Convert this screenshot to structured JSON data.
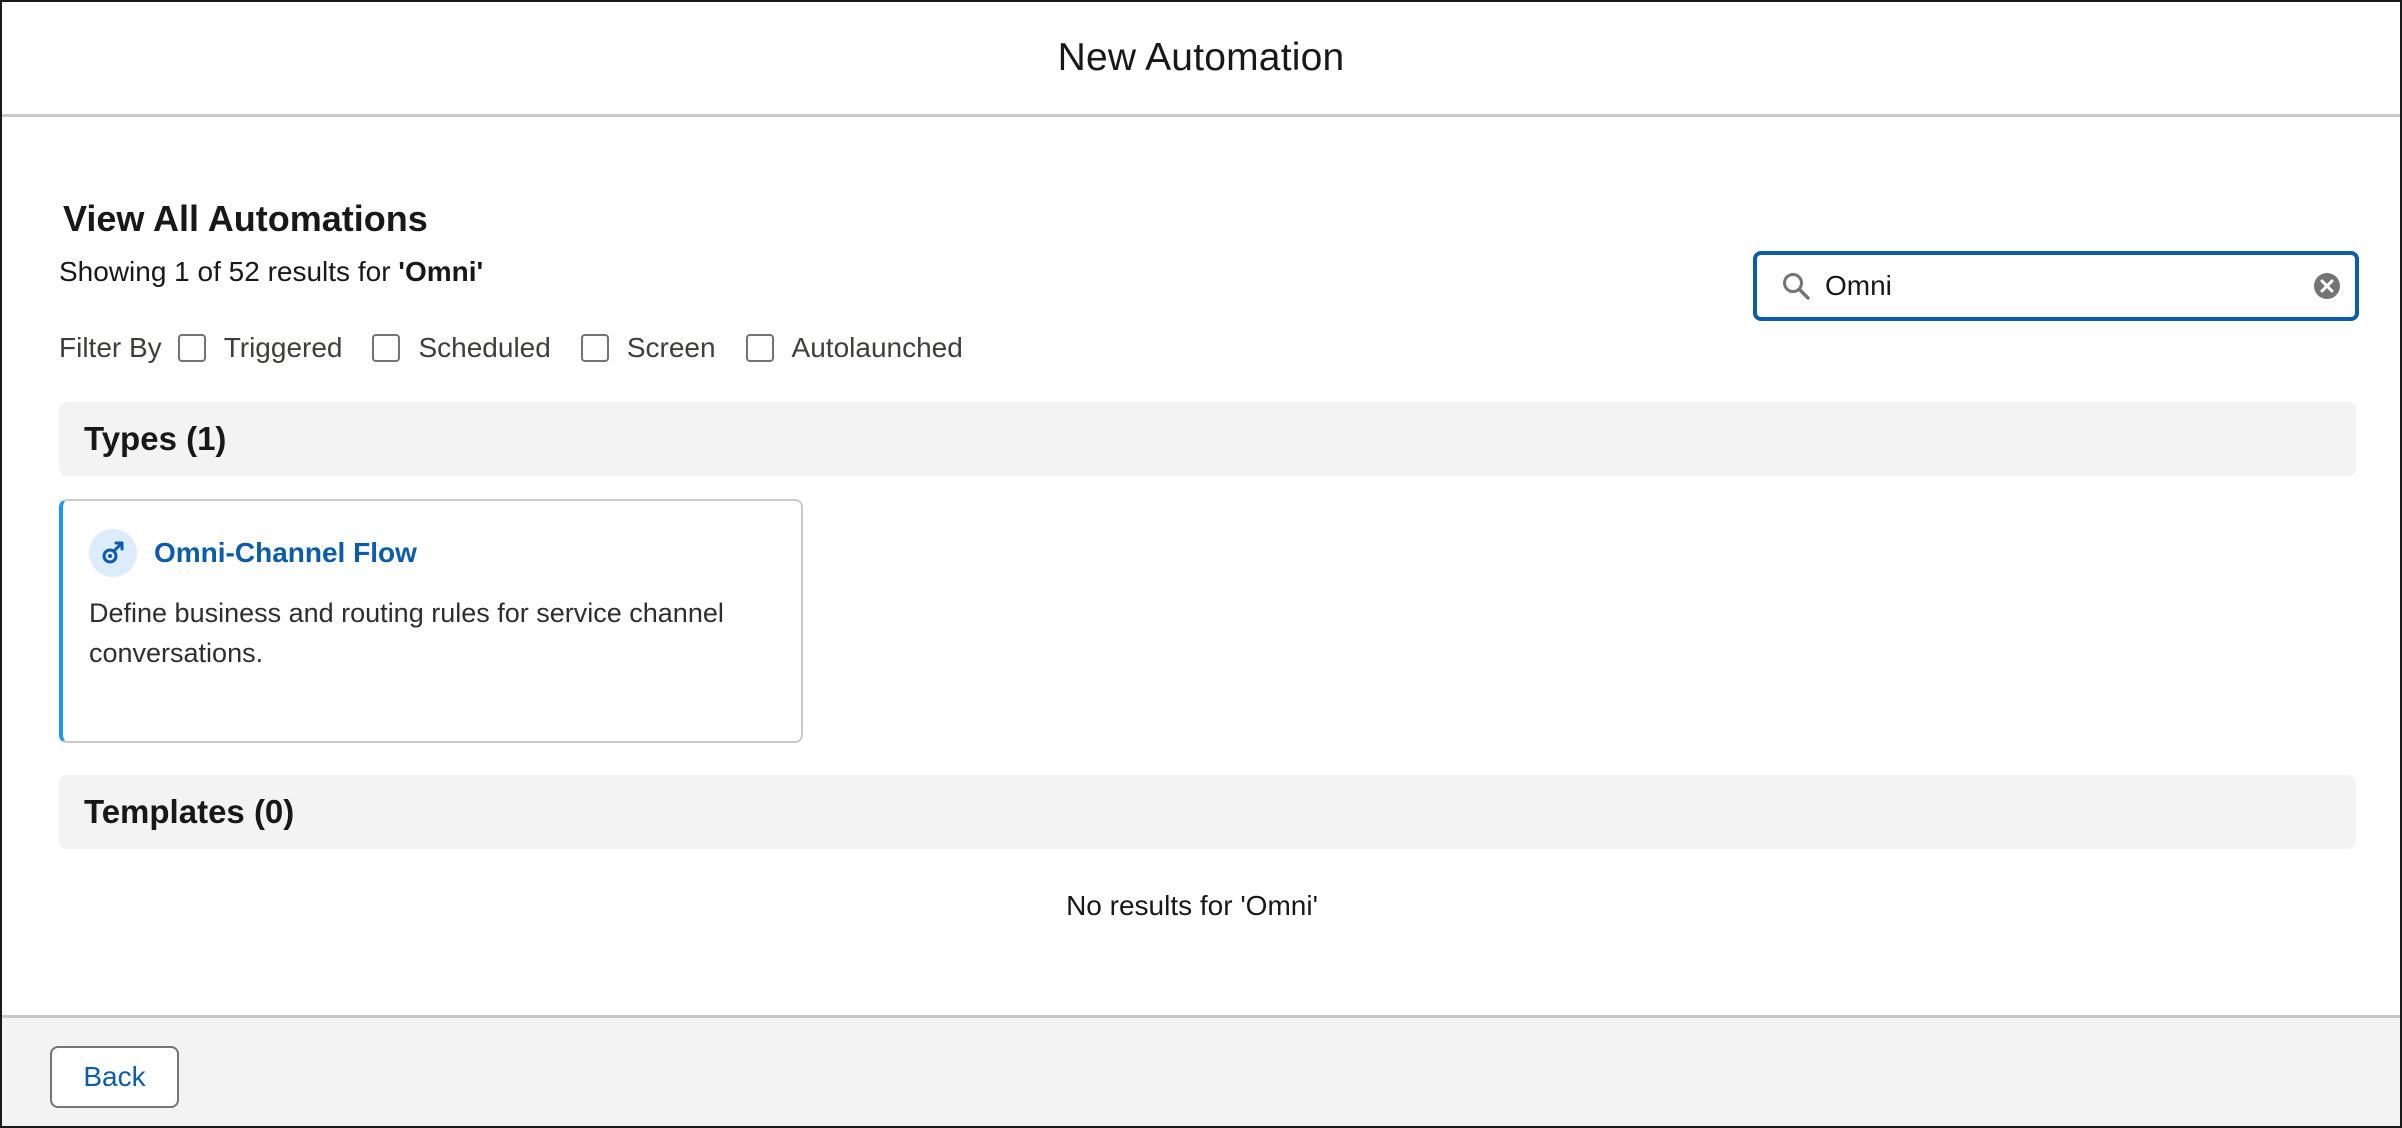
{
  "modal": {
    "title": "New Automation"
  },
  "page": {
    "heading": "View All Automations",
    "results_prefix": "Showing 1 of 52 results for ",
    "results_query": "'Omni'"
  },
  "filters": {
    "label": "Filter By",
    "options": [
      {
        "label": "Triggered",
        "checked": false
      },
      {
        "label": "Scheduled",
        "checked": false
      },
      {
        "label": "Screen",
        "checked": false
      },
      {
        "label": "Autolaunched",
        "checked": false
      }
    ]
  },
  "search": {
    "value": "Omni",
    "icon": "search-icon",
    "clear_icon": "clear-icon"
  },
  "types_section": {
    "title": "Types (1)",
    "cards": [
      {
        "title": "Omni-Channel Flow",
        "description": "Define business and routing rules for service channel conversations.",
        "icon": "omni-channel-flow-icon"
      }
    ]
  },
  "templates_section": {
    "title": "Templates (0)",
    "empty_message": "No results for 'Omni'"
  },
  "footer": {
    "back_label": "Back"
  },
  "colors": {
    "accent": "#0b5cab",
    "card_highlight": "#1b96ff",
    "section_bg": "#f3f3f3"
  }
}
